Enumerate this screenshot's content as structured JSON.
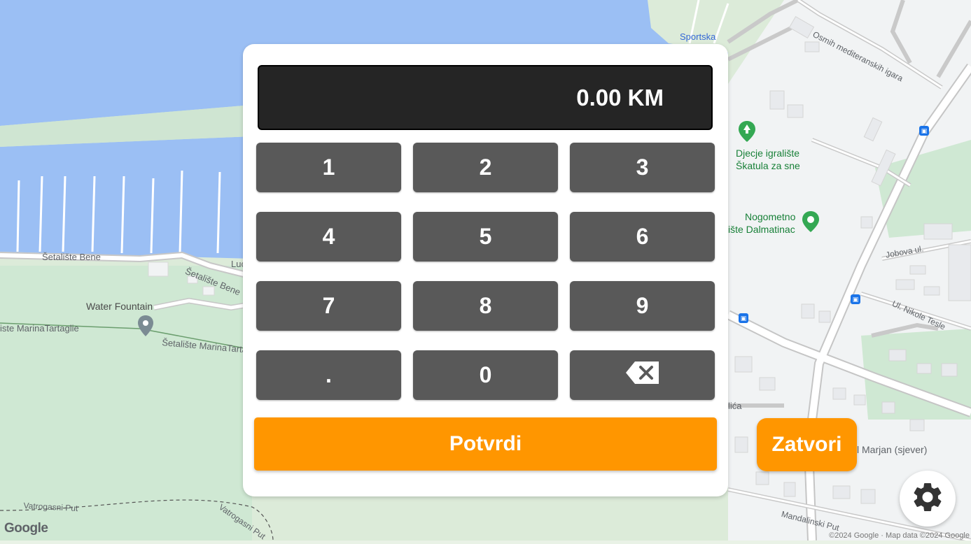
{
  "map": {
    "labels": {
      "sportska": "Sportska",
      "osmih": "Osmih mediteranskih igara",
      "setaliste_bene_1": "Šetalište Bene",
      "setaliste_bene_2": "Šetalište Bene",
      "luc": "Luc",
      "water_fountain": "Water Fountain",
      "marina_1": "iste MarinaTartaglie",
      "marina_2": "Šetalište MarinaTarta",
      "djecje_1": "Djecje igralište",
      "djecje_2": "Škatula za sne",
      "nogometno_1": "Nogometno",
      "nogometno_2": "ište Dalmatinac",
      "jobova": "Jobova ul.",
      "nikole_tesle": "Ul. Nikole Tesle",
      "lica": "lića",
      "marjan": "l Marjan (sjever)",
      "vatrogasni_1": "Vatrogasni Put",
      "vatrogasni_2": "Vatrogasni Put",
      "mandalinski": "Mandalinski Put"
    },
    "google_logo": "Google",
    "attribution": "©2024 Google · Map data ©2024 Google"
  },
  "keypad": {
    "display_value": "0.00 KM",
    "keys": [
      "1",
      "2",
      "3",
      "4",
      "5",
      "6",
      "7",
      "8",
      "9",
      ".",
      "0"
    ],
    "confirm_label": "Potvrdi"
  },
  "close_label": "Zatvori",
  "icons": {
    "backspace": "backspace-icon",
    "settings": "gear-icon",
    "park": "tree-pin-icon",
    "stadium": "stadium-pin-icon",
    "fountain": "place-pin-icon",
    "bus": "bus-stop-icon"
  },
  "colors": {
    "accent": "#ff9600",
    "key": "#595959",
    "display": "#252525",
    "water": "#9bbff4",
    "park": "#cfe8d3"
  }
}
